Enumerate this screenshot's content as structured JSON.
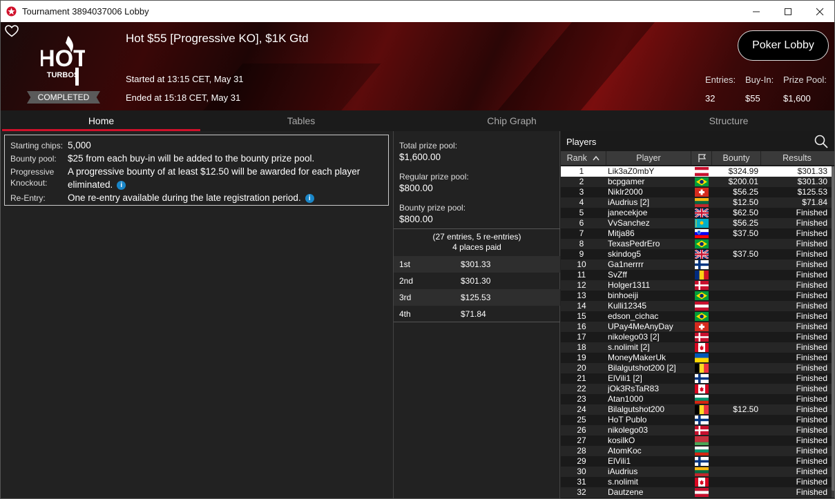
{
  "window": {
    "title": "Tournament 3894037006 Lobby"
  },
  "banner": {
    "name": "Hot $55 [Progressive KO], $1K Gtd",
    "started": "Started at 13:15 CET, May 31",
    "ended": "Ended at 15:18 CET, May 31",
    "status": "COMPLETED",
    "logo_text_top": "HOT",
    "logo_text_bottom": "TURBOS",
    "lobby_button": "Poker Lobby",
    "entries_label": "Entries:",
    "entries_value": "32",
    "buyin_label": "Buy-In:",
    "buyin_value": "$55",
    "prizepool_label": "Prize Pool:",
    "prizepool_value": "$1,600"
  },
  "tabs": [
    {
      "label": "Home",
      "active": true
    },
    {
      "label": "Tables",
      "active": false
    },
    {
      "label": "Chip Graph",
      "active": false
    },
    {
      "label": "Structure",
      "active": false
    }
  ],
  "home": {
    "starting_chips_label": "Starting chips:",
    "starting_chips_value": "5,000",
    "bounty_pool_label": "Bounty pool:",
    "bounty_pool_value": "$25 from each buy-in will be added to the bounty prize pool.",
    "pko_label_1": "Progressive",
    "pko_label_2": "Knockout:",
    "pko_value_1": "A progressive bounty of at least $12.50 will be awarded for each player",
    "pko_value_2": "eliminated.",
    "reentry_label": "Re-Entry:",
    "reentry_value": "One re-entry available during the late registration period."
  },
  "prizes": {
    "total_label": "Total prize pool:",
    "total_value": "$1,600.00",
    "regular_label": "Regular prize pool:",
    "regular_value": "$800.00",
    "bounty_label": "Bounty prize pool:",
    "bounty_value": "$800.00",
    "entries_note": "(27 entries, 5 re-entries)",
    "places_note": "4 places paid",
    "places": [
      {
        "place": "1st",
        "amount": "$301.33"
      },
      {
        "place": "2nd",
        "amount": "$301.30"
      },
      {
        "place": "3rd",
        "amount": "$125.53"
      },
      {
        "place": "4th",
        "amount": "$71.84"
      }
    ]
  },
  "players": {
    "title": "Players",
    "columns": {
      "rank": "Rank",
      "player": "Player",
      "bounty": "Bounty",
      "results": "Results"
    },
    "rows": [
      {
        "rank": "1",
        "name": "Lik3aZ0mbY",
        "flag": "at",
        "bounty": "$324.99",
        "result": "$301.33"
      },
      {
        "rank": "2",
        "name": "bcpgamer",
        "flag": "br",
        "bounty": "$200.01",
        "result": "$301.30"
      },
      {
        "rank": "3",
        "name": "Niklr2000",
        "flag": "ch",
        "bounty": "$56.25",
        "result": "$125.53"
      },
      {
        "rank": "4",
        "name": "iAudrius [2]",
        "flag": "lt",
        "bounty": "$12.50",
        "result": "$71.84"
      },
      {
        "rank": "5",
        "name": "janecekjoe",
        "flag": "gb",
        "bounty": "$62.50",
        "result": "Finished"
      },
      {
        "rank": "6",
        "name": "VvSanchez",
        "flag": "kz",
        "bounty": "$56.25",
        "result": "Finished"
      },
      {
        "rank": "7",
        "name": "Mitja86",
        "flag": "si",
        "bounty": "$37.50",
        "result": "Finished"
      },
      {
        "rank": "8",
        "name": "TexasPedrEro",
        "flag": "br",
        "bounty": "",
        "result": "Finished"
      },
      {
        "rank": "9",
        "name": "skindog5",
        "flag": "gb",
        "bounty": "$37.50",
        "result": "Finished"
      },
      {
        "rank": "10",
        "name": "Ga1nerrrr",
        "flag": "fi",
        "bounty": "",
        "result": "Finished"
      },
      {
        "rank": "11",
        "name": "SvZff",
        "flag": "ro",
        "bounty": "",
        "result": "Finished"
      },
      {
        "rank": "12",
        "name": "Holger1311",
        "flag": "dk",
        "bounty": "",
        "result": "Finished"
      },
      {
        "rank": "13",
        "name": "binhoeiji",
        "flag": "br",
        "bounty": "",
        "result": "Finished"
      },
      {
        "rank": "14",
        "name": "Kulli12345",
        "flag": "at",
        "bounty": "",
        "result": "Finished"
      },
      {
        "rank": "15",
        "name": "edson_cichac",
        "flag": "br",
        "bounty": "",
        "result": "Finished"
      },
      {
        "rank": "16",
        "name": "UPay4MeAnyDay",
        "flag": "ch",
        "bounty": "",
        "result": "Finished"
      },
      {
        "rank": "17",
        "name": "nikolego03 [2]",
        "flag": "dk",
        "bounty": "",
        "result": "Finished"
      },
      {
        "rank": "18",
        "name": "s.nolimit [2]",
        "flag": "ca",
        "bounty": "",
        "result": "Finished"
      },
      {
        "rank": "19",
        "name": "MoneyMakerUk",
        "flag": "ua",
        "bounty": "",
        "result": "Finished"
      },
      {
        "rank": "20",
        "name": "Bilalgutshot200 [2]",
        "flag": "be",
        "bounty": "",
        "result": "Finished"
      },
      {
        "rank": "21",
        "name": "ElVili1 [2]",
        "flag": "fi",
        "bounty": "",
        "result": "Finished"
      },
      {
        "rank": "22",
        "name": "jOk3RsTaR83",
        "flag": "ca",
        "bounty": "",
        "result": "Finished"
      },
      {
        "rank": "23",
        "name": "Atan1000",
        "flag": "bg",
        "bounty": "",
        "result": "Finished"
      },
      {
        "rank": "24",
        "name": "Bilalgutshot200",
        "flag": "be",
        "bounty": "$12.50",
        "result": "Finished"
      },
      {
        "rank": "25",
        "name": "HoT Publo",
        "flag": "fi",
        "bounty": "",
        "result": "Finished"
      },
      {
        "rank": "26",
        "name": "nikolego03",
        "flag": "dk",
        "bounty": "",
        "result": "Finished"
      },
      {
        "rank": "27",
        "name": "kosilkO",
        "flag": "by",
        "bounty": "",
        "result": "Finished"
      },
      {
        "rank": "28",
        "name": "AtomKoc",
        "flag": "bg",
        "bounty": "",
        "result": "Finished"
      },
      {
        "rank": "29",
        "name": "ElVili1",
        "flag": "fi",
        "bounty": "",
        "result": "Finished"
      },
      {
        "rank": "30",
        "name": "iAudrius",
        "flag": "lt",
        "bounty": "",
        "result": "Finished"
      },
      {
        "rank": "31",
        "name": "s.nolimit",
        "flag": "ca",
        "bounty": "",
        "result": "Finished"
      },
      {
        "rank": "32",
        "name": "Dautzene",
        "flag": "at",
        "bounty": "",
        "result": "Finished"
      }
    ]
  },
  "colors": {
    "accent": "#d0102a",
    "info": "#1a86c8"
  }
}
